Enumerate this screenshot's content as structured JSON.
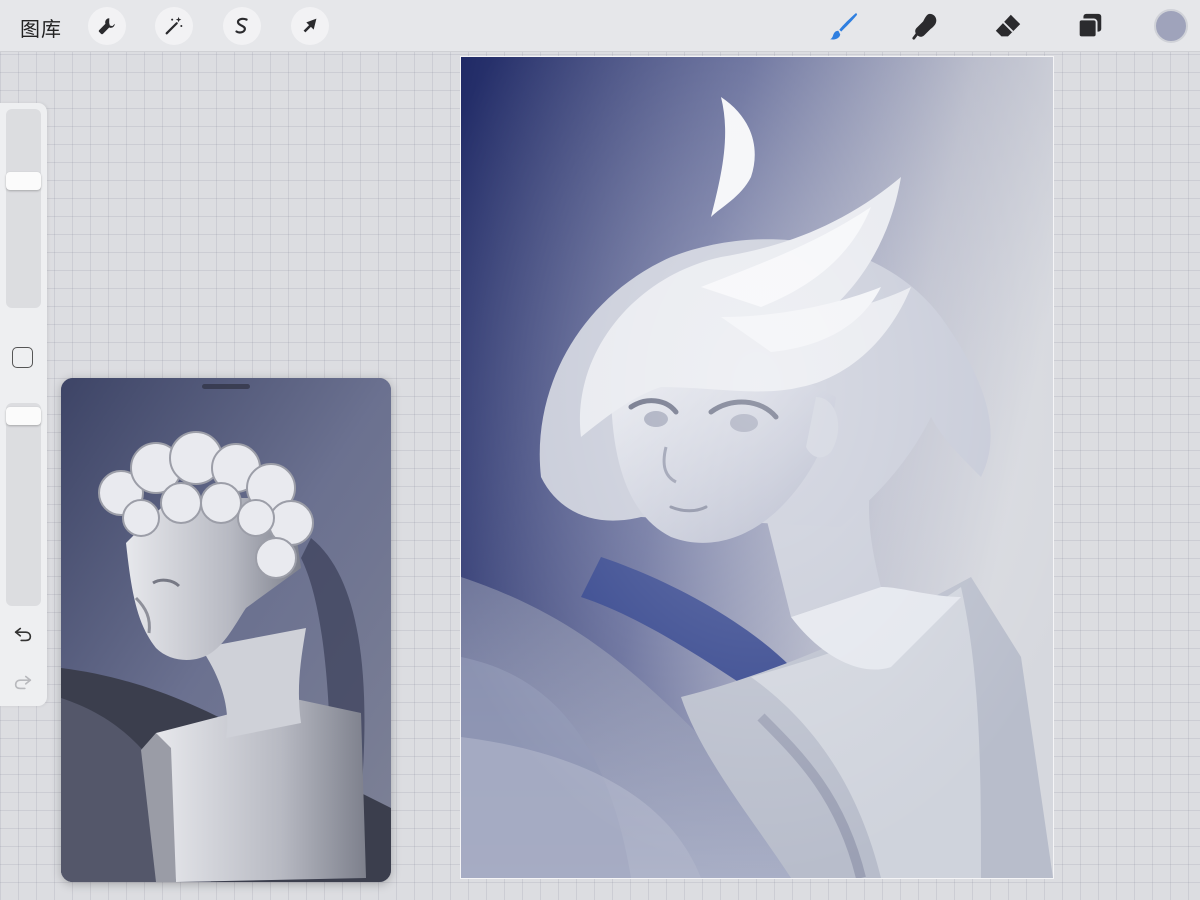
{
  "topbar": {
    "gallery_label": "图库",
    "left_tools": [
      {
        "name": "actions",
        "icon": "wrench-icon"
      },
      {
        "name": "adjustments",
        "icon": "magic-wand-icon"
      },
      {
        "name": "selection",
        "icon": "selection-s-icon"
      },
      {
        "name": "transform",
        "icon": "arrow-cursor-icon"
      }
    ],
    "right_tools": [
      {
        "name": "brush",
        "icon": "brush-icon",
        "active": true
      },
      {
        "name": "smudge",
        "icon": "smudge-finger-icon",
        "active": false
      },
      {
        "name": "eraser",
        "icon": "eraser-icon",
        "active": false
      },
      {
        "name": "layers",
        "icon": "layers-icon",
        "active": false
      }
    ],
    "current_color": "#9fa3bb"
  },
  "sidebar": {
    "brush_size_level": 0.35,
    "opacity_level": 0.02,
    "modify_icon": "square-outline-icon",
    "undo_icon": "undo-arrow-icon",
    "redo_icon": "redo-arrow-icon"
  },
  "colors": {
    "accent": "#2f7fe0",
    "toolbar_bg": "#e6e7ea",
    "canvas_bg": "#dcdde1",
    "painting_dark": "#26306a",
    "painting_light": "#eef0f4"
  }
}
